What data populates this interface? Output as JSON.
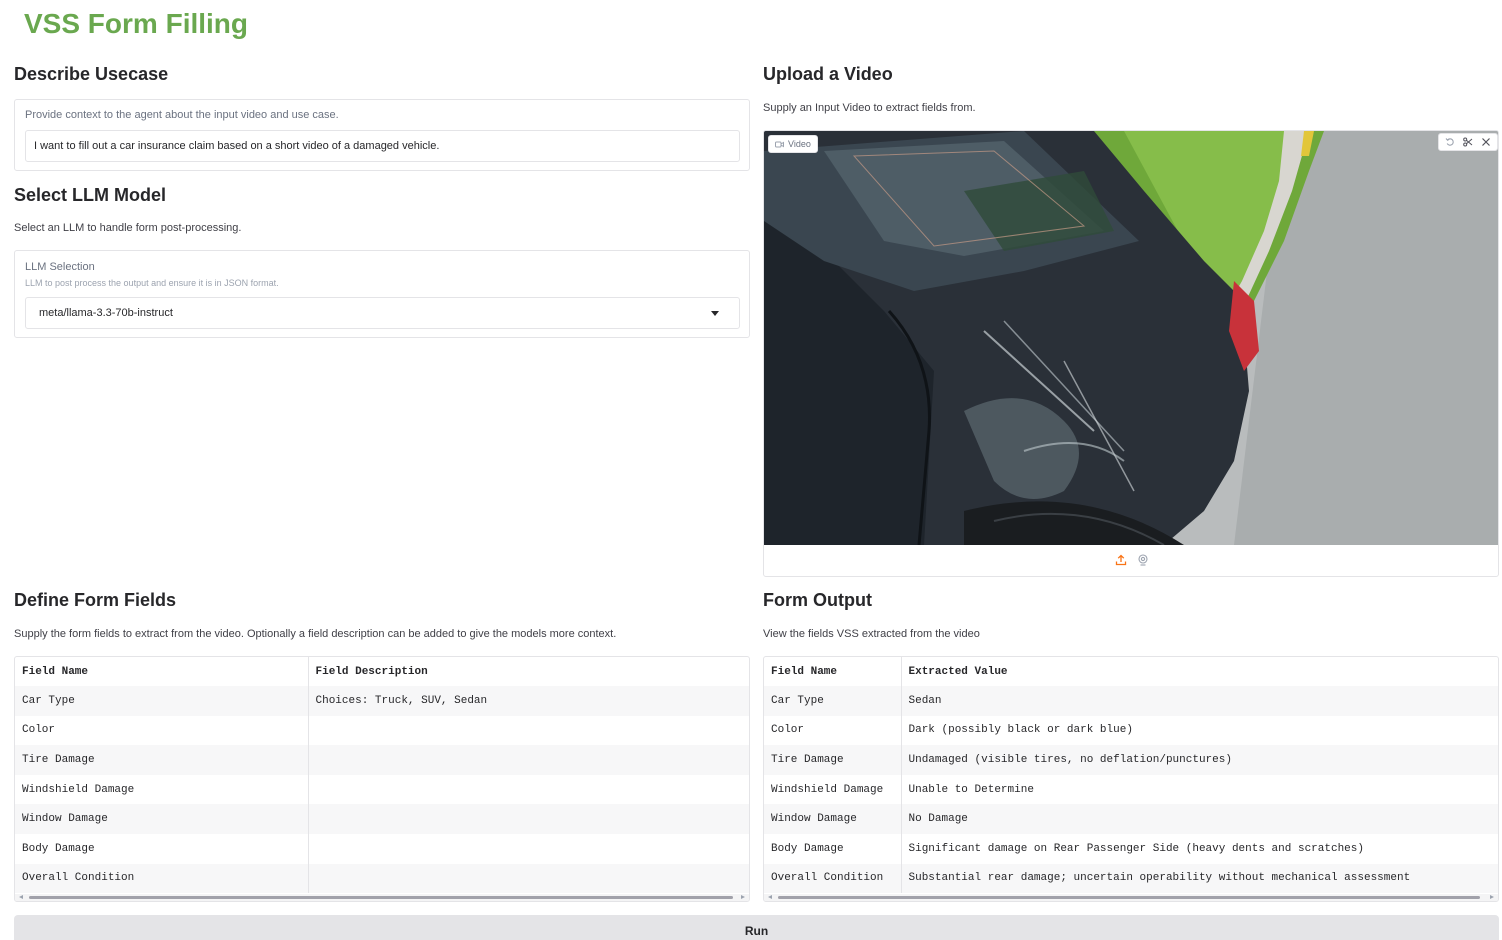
{
  "app": {
    "title": "VSS Form Filling"
  },
  "usecase": {
    "title": "Describe Usecase",
    "label": "Provide context to the agent about the input video and use case.",
    "value": "I want to fill out a car insurance claim based on a short video of a damaged vehicle."
  },
  "llm": {
    "title": "Select LLM Model",
    "description": "Select an LLM to handle form post-processing.",
    "label": "LLM Selection",
    "info": "LLM to post process the output and ensure it is in JSON format.",
    "selected": "meta/llama-3.3-70b-instruct"
  },
  "video": {
    "title": "Upload a Video",
    "description": "Supply an Input Video to extract fields from.",
    "chip_label": "Video",
    "icons": {
      "chip": "video-camera-icon",
      "actions": [
        "undo-icon",
        "scissors-icon",
        "close-icon"
      ],
      "bottom": [
        "upload-icon",
        "webcam-icon"
      ]
    }
  },
  "fields": {
    "title": "Define Form Fields",
    "description": "Supply the form fields to extract from the video. Optionally a field description can be added to give the models more context.",
    "headers": [
      "Field Name",
      "Field Description"
    ],
    "rows": [
      [
        "Car Type",
        "Choices: Truck, SUV, Sedan"
      ],
      [
        "Color",
        ""
      ],
      [
        "Tire Damage",
        ""
      ],
      [
        "Windshield Damage",
        ""
      ],
      [
        "Window Damage",
        ""
      ],
      [
        "Body Damage",
        ""
      ],
      [
        "Overall Condition",
        ""
      ]
    ]
  },
  "output": {
    "title": "Form Output",
    "description": "View the fields VSS extracted from the video",
    "headers": [
      "Field Name",
      "Extracted Value"
    ],
    "rows": [
      [
        "Car Type",
        "Sedan"
      ],
      [
        "Color",
        "Dark (possibly black or dark blue)"
      ],
      [
        "Tire Damage",
        "Undamaged (visible tires, no deflation/punctures)"
      ],
      [
        "Windshield Damage",
        "Unable to Determine"
      ],
      [
        "Window Damage",
        "No Damage"
      ],
      [
        "Body Damage",
        "Significant damage on Rear Passenger Side (heavy dents and scratches)"
      ],
      [
        "Overall Condition",
        "Substantial rear damage; uncertain operability without mechanical assessment"
      ]
    ]
  },
  "run": {
    "label": "Run"
  },
  "colors": {
    "title_green": "#6aa84f",
    "border": "#e4e4e7",
    "button_bg": "#e4e4e7"
  }
}
